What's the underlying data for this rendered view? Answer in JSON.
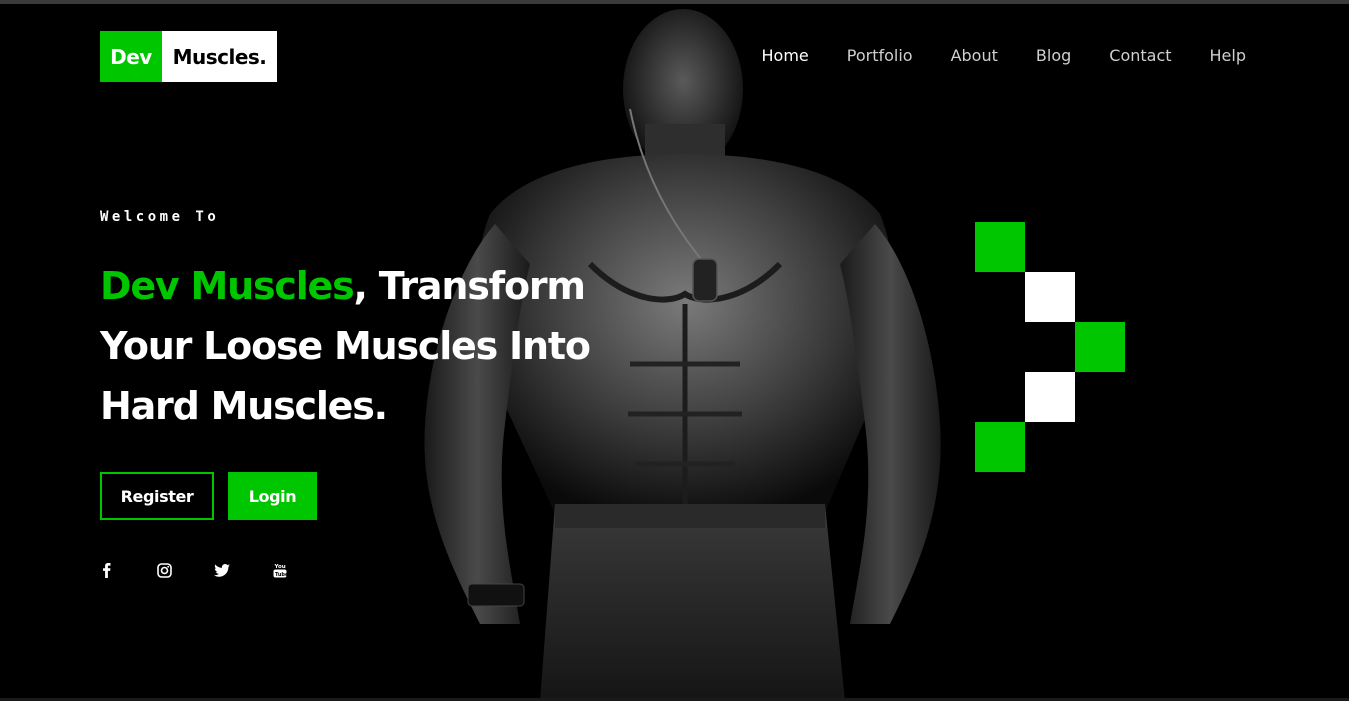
{
  "brand": {
    "part1": "Dev",
    "part2": "Muscles.",
    "accent_color": "#00c600"
  },
  "nav": {
    "items": [
      {
        "label": "Home",
        "active": true
      },
      {
        "label": "Portfolio",
        "active": false
      },
      {
        "label": "About",
        "active": false
      },
      {
        "label": "Blog",
        "active": false
      },
      {
        "label": "Contact",
        "active": false
      },
      {
        "label": "Help",
        "active": false
      }
    ]
  },
  "hero": {
    "welcome": "Welcome To",
    "headline_accent": "Dev Muscles",
    "headline_rest_1": ", Transform",
    "headline_rest_2": "Your Loose Muscles Into",
    "headline_rest_3": "Hard Muscles."
  },
  "buttons": {
    "register": "Register",
    "login": "Login"
  },
  "socials": [
    "facebook-icon",
    "instagram-icon",
    "twitter-icon",
    "youtube-icon"
  ],
  "decoration": {
    "colors": [
      "#00c600",
      "#ffffff"
    ]
  }
}
